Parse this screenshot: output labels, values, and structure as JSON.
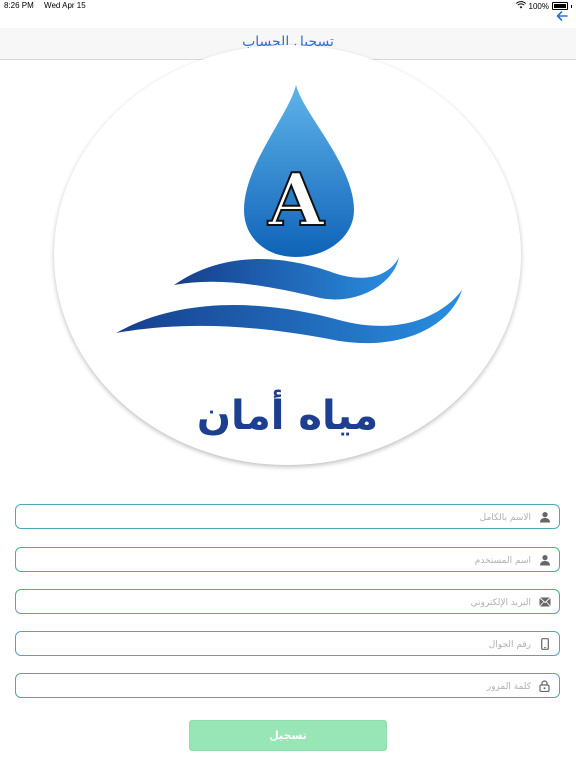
{
  "status_bar": {
    "time": "8:26 PM",
    "date": "Wed Apr 15",
    "battery": "100%",
    "icons": [
      "wifi-icon",
      "battery-icon"
    ]
  },
  "nav": {
    "title": "تسجيل الحساب",
    "back_icon": "arrow-left-icon"
  },
  "logo": {
    "letter": "A",
    "text": "مياه أمان"
  },
  "form": {
    "fields": [
      {
        "placeholder": "الاسم بالكامل",
        "icon": "person-icon"
      },
      {
        "placeholder": "اسم المستخدم",
        "icon": "person-icon"
      },
      {
        "placeholder": "البريد الإلكتروني",
        "icon": "envelope-icon"
      },
      {
        "placeholder": "رقم الجوال",
        "icon": "phone-icon"
      },
      {
        "placeholder": "كلمة المرور",
        "icon": "lock-icon"
      }
    ],
    "submit_label": "تسجيل"
  },
  "colors": {
    "accent": "#2f6fd6",
    "field_border": "#4aa9b8",
    "submit_bg": "#98e6b5",
    "logo_text": "#1e3f8f"
  }
}
